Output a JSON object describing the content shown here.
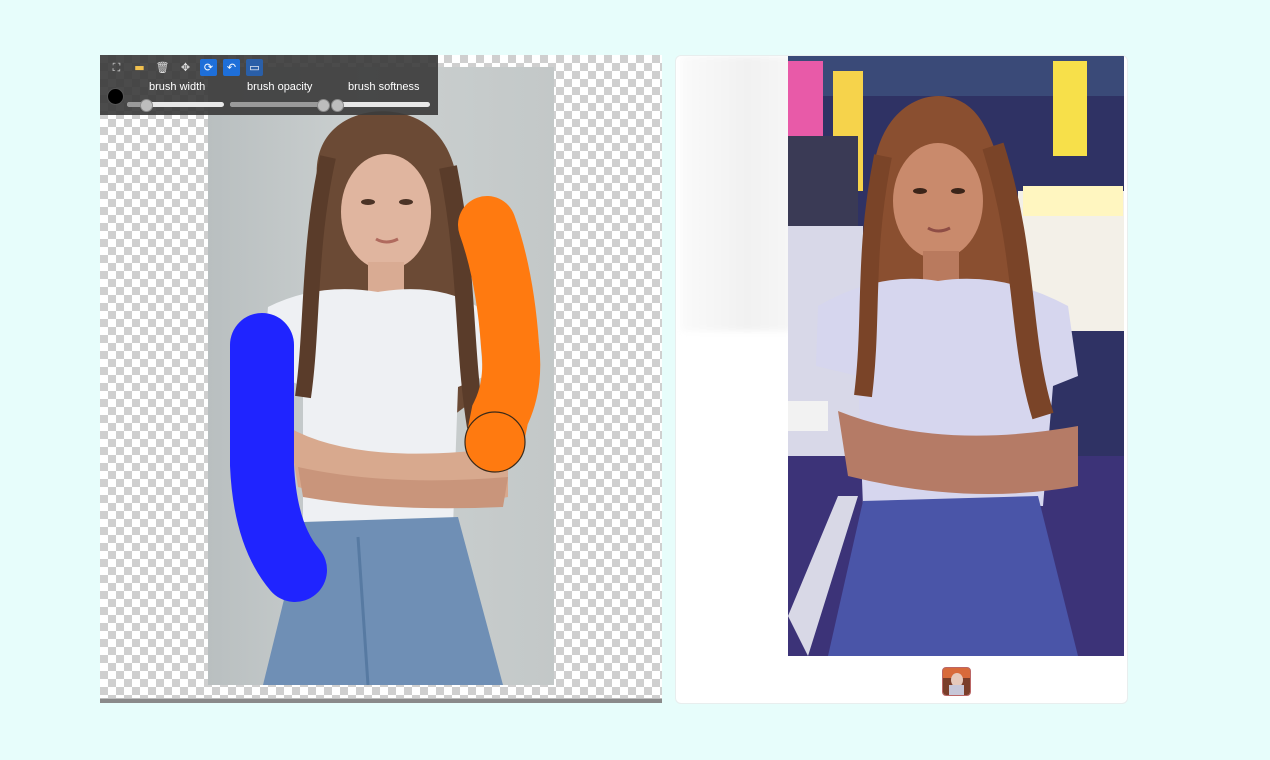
{
  "toolbar": {
    "tools": [
      {
        "name": "fullscreen-icon",
        "glyph": "⛶"
      },
      {
        "name": "folder-icon",
        "glyph": "📂"
      },
      {
        "name": "trash-icon",
        "glyph": "🗑"
      },
      {
        "name": "move-icon",
        "glyph": "✥"
      },
      {
        "name": "refresh-icon",
        "glyph": "⟳"
      },
      {
        "name": "undo-icon",
        "glyph": "↶"
      },
      {
        "name": "layer-icon",
        "glyph": "▭"
      }
    ],
    "brush_color": "#000000",
    "brush_width_label": "brush width",
    "brush_opacity_label": "brush opacity",
    "brush_softness_label": "brush softness",
    "brush_width_value": 0.2,
    "brush_opacity_value": 0.96,
    "brush_softness_value": 0.04
  },
  "colors": {
    "stroke_blue": "#1f24ff",
    "stroke_orange": "#ff7a10",
    "accent_button": "#1e6fd9"
  }
}
